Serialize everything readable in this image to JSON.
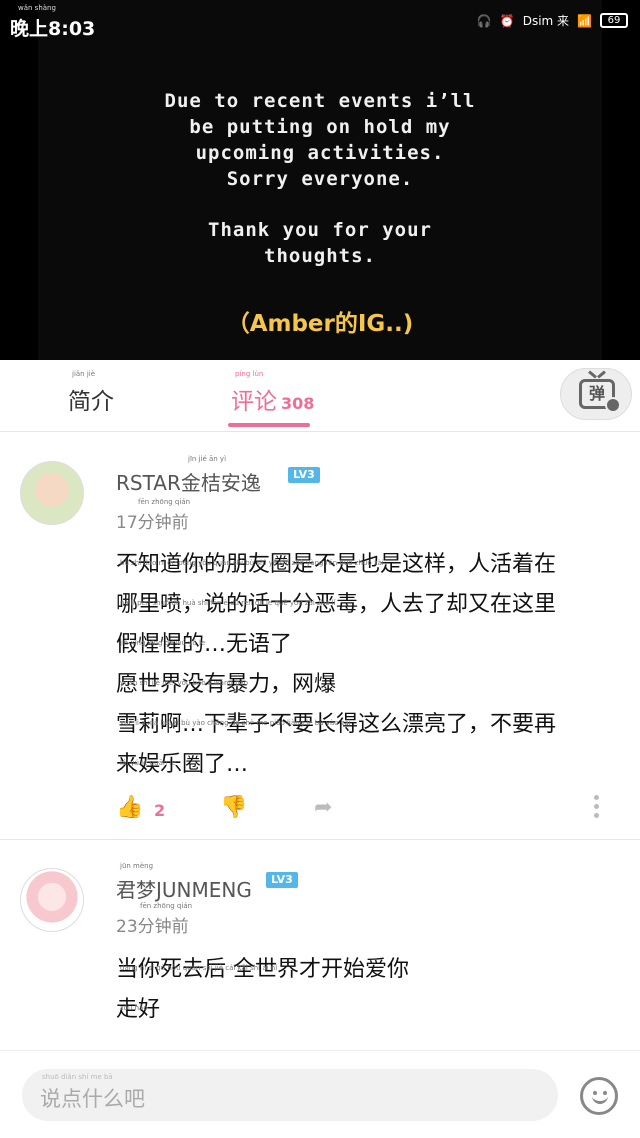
{
  "status_bar": {
    "time": "晚上8:03",
    "time_ruby": "wǎn shàng",
    "battery": "69",
    "carrier": "Dsim 来"
  },
  "video": {
    "lines": [
      "Due to recent events i’ll",
      "be putting on hold my",
      "upcoming activities.",
      "Sorry everyone.",
      "",
      "Thank you for your",
      "thoughts."
    ],
    "caption": "（Amber的IG..)"
  },
  "tabs": {
    "intro_label": "简介",
    "intro_ruby": "jiǎn  jiè",
    "comments_label": "评论",
    "comments_ruby": "píng   lùn",
    "comments_count": "308",
    "danmaku_label": "弹"
  },
  "comments": [
    {
      "username": "RSTAR金桔安逸",
      "username_ruby": "jīn  jié  ān  yì",
      "level": "LV3",
      "time": "17分钟前",
      "time_ruby": "fēn zhōng qián",
      "lines": [
        {
          "ruby": "bù  zhī  dào  nǐ   de  péng yǒu quān shì  bù  shì  yě  shì  zhè yàng      rén huó zhuó zài",
          "text": "不知道你的朋友圈是不是也是这样，人活着在"
        },
        {
          "ruby": "nǎ  lǐ  pēn      shuō  de  huà  shí  fēn  è   dú      rén  qù  le  què  yòu  zài  zhè  lǐ",
          "text": "哪里喷，说的话十分恶毒，人去了却又在这里"
        },
        {
          "ruby": "jiǎ  xīng xīng  de         wú  yǔ  le",
          "text": "假惺惺的…无语了"
        },
        {
          "ruby": "yuàn shì  jiè  méi  yǒu  bào  lì      wǎng bào",
          "text": "愿世界没有暴力，网爆"
        },
        {
          "ruby": "xuě  lì   ā       xià  bèi  zǐ  bù  yào cháng de  zhè  me  piào liàng le    bù  yào zài",
          "text": "雪莉啊…下辈子不要长得这么漂亮了，不要再"
        },
        {
          "ruby": "lái  yú  lè  quān le",
          "text": "来娱乐圈了…"
        }
      ],
      "likes": "2"
    },
    {
      "username": "君梦JUNMENG",
      "username_ruby": "jūn mèng",
      "level": "LV3",
      "time": "23分钟前",
      "time_ruby": "fēn zhōng qián",
      "lines": [
        {
          "ruby": "dāng  nǐ   sǐ   qù  hòu   quán shì  jiè  cái  kāi  shǐ  ài   nǐ",
          "text": "当你死去后 全世界才开始爱你"
        },
        {
          "ruby": "zǒu hǎo",
          "text": "走好"
        }
      ]
    }
  ],
  "input": {
    "placeholder": "说点什么吧",
    "placeholder_ruby": "shuō diǎn shí  me  bā"
  },
  "colors": {
    "accent": "#f06e95",
    "level_badge": "#55b6e8",
    "caption": "#f5c64a"
  }
}
